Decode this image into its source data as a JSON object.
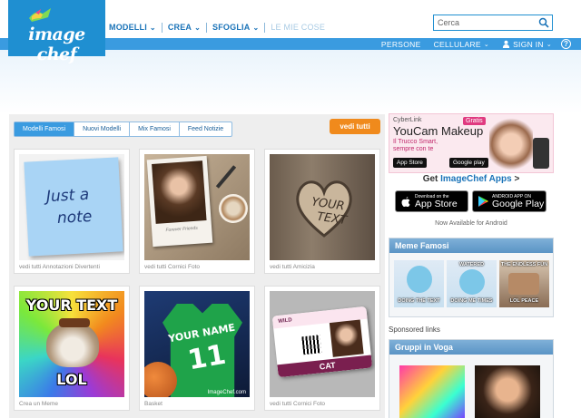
{
  "header": {
    "logo_text": "image chef",
    "nav": [
      {
        "label": "MODELLI"
      },
      {
        "label": "CREA"
      },
      {
        "label": "SFOGLIA"
      }
    ],
    "nav_disabled": "LE MIE COSE",
    "search_placeholder": "Cerca"
  },
  "subnav": {
    "persone": "PERSONE",
    "cellulare": "CELLULARE",
    "sign_in": "SIGN IN",
    "help": "?"
  },
  "main": {
    "tabs": [
      "Modelli Famosi",
      "Nuovi Modelli",
      "Mix Famosi",
      "Feed Notizie"
    ],
    "active_tab": "Modelli Famosi",
    "vedi_tutti": "vedi tutti",
    "cards": [
      {
        "caption": "vedi tutti Annotazioni Divertenti",
        "art_text_1": "Just a",
        "art_text_2": "note"
      },
      {
        "caption": "vedi tutti Cornici Foto",
        "art_text_1": "Forever Friends"
      },
      {
        "caption": "vedi tutti Amicizia",
        "art_text_1": "YOUR",
        "art_text_2": "TEXT"
      },
      {
        "caption": "Crea un Meme",
        "art_text_1": "YOUR TEXT",
        "art_text_2": "LOL"
      },
      {
        "caption": "Basket",
        "art_text_1": "YOUR NAME",
        "art_text_2": "11",
        "art_text_3": "ImageChef.com"
      },
      {
        "caption": "vedi tutti Cornici Foto",
        "art_text_1": "WILD",
        "art_text_2": "CAT"
      }
    ]
  },
  "sidebar": {
    "ad": {
      "brand": "CyberLink",
      "title": "YouCam Makeup",
      "free": "Gratis",
      "tagline_1": "Il Trucco Smart,",
      "tagline_2": "sempre con te",
      "app_store": "App Store",
      "google_play": "Google play"
    },
    "get_apps_prefix": "Get ",
    "get_apps_link": "ImageChef Apps",
    "get_apps_suffix": " >",
    "app_store_small": "Download on the",
    "app_store_big": "App Store",
    "google_play_small": "ANDROID APP ON",
    "google_play_big": "Google Play",
    "android_note": "Now Available for Android",
    "meme_panel_title": "Meme Famosi",
    "meme_texts": [
      {
        "top": "",
        "bottom": "DOING THE TEXT"
      },
      {
        "top": "WATERED",
        "bottom": "DOING ME TIMES"
      },
      {
        "top": "THE ENDLESS FUN",
        "bottom": "LOL PEACE"
      }
    ],
    "sponsored": "Sponsored links",
    "groups_panel_title": "Gruppi in Voga"
  },
  "colors": {
    "brand_blue": "#1f8fd1",
    "nav_blue": "#1a73b8",
    "bar_blue": "#3a9be0",
    "orange": "#f08a1c"
  }
}
